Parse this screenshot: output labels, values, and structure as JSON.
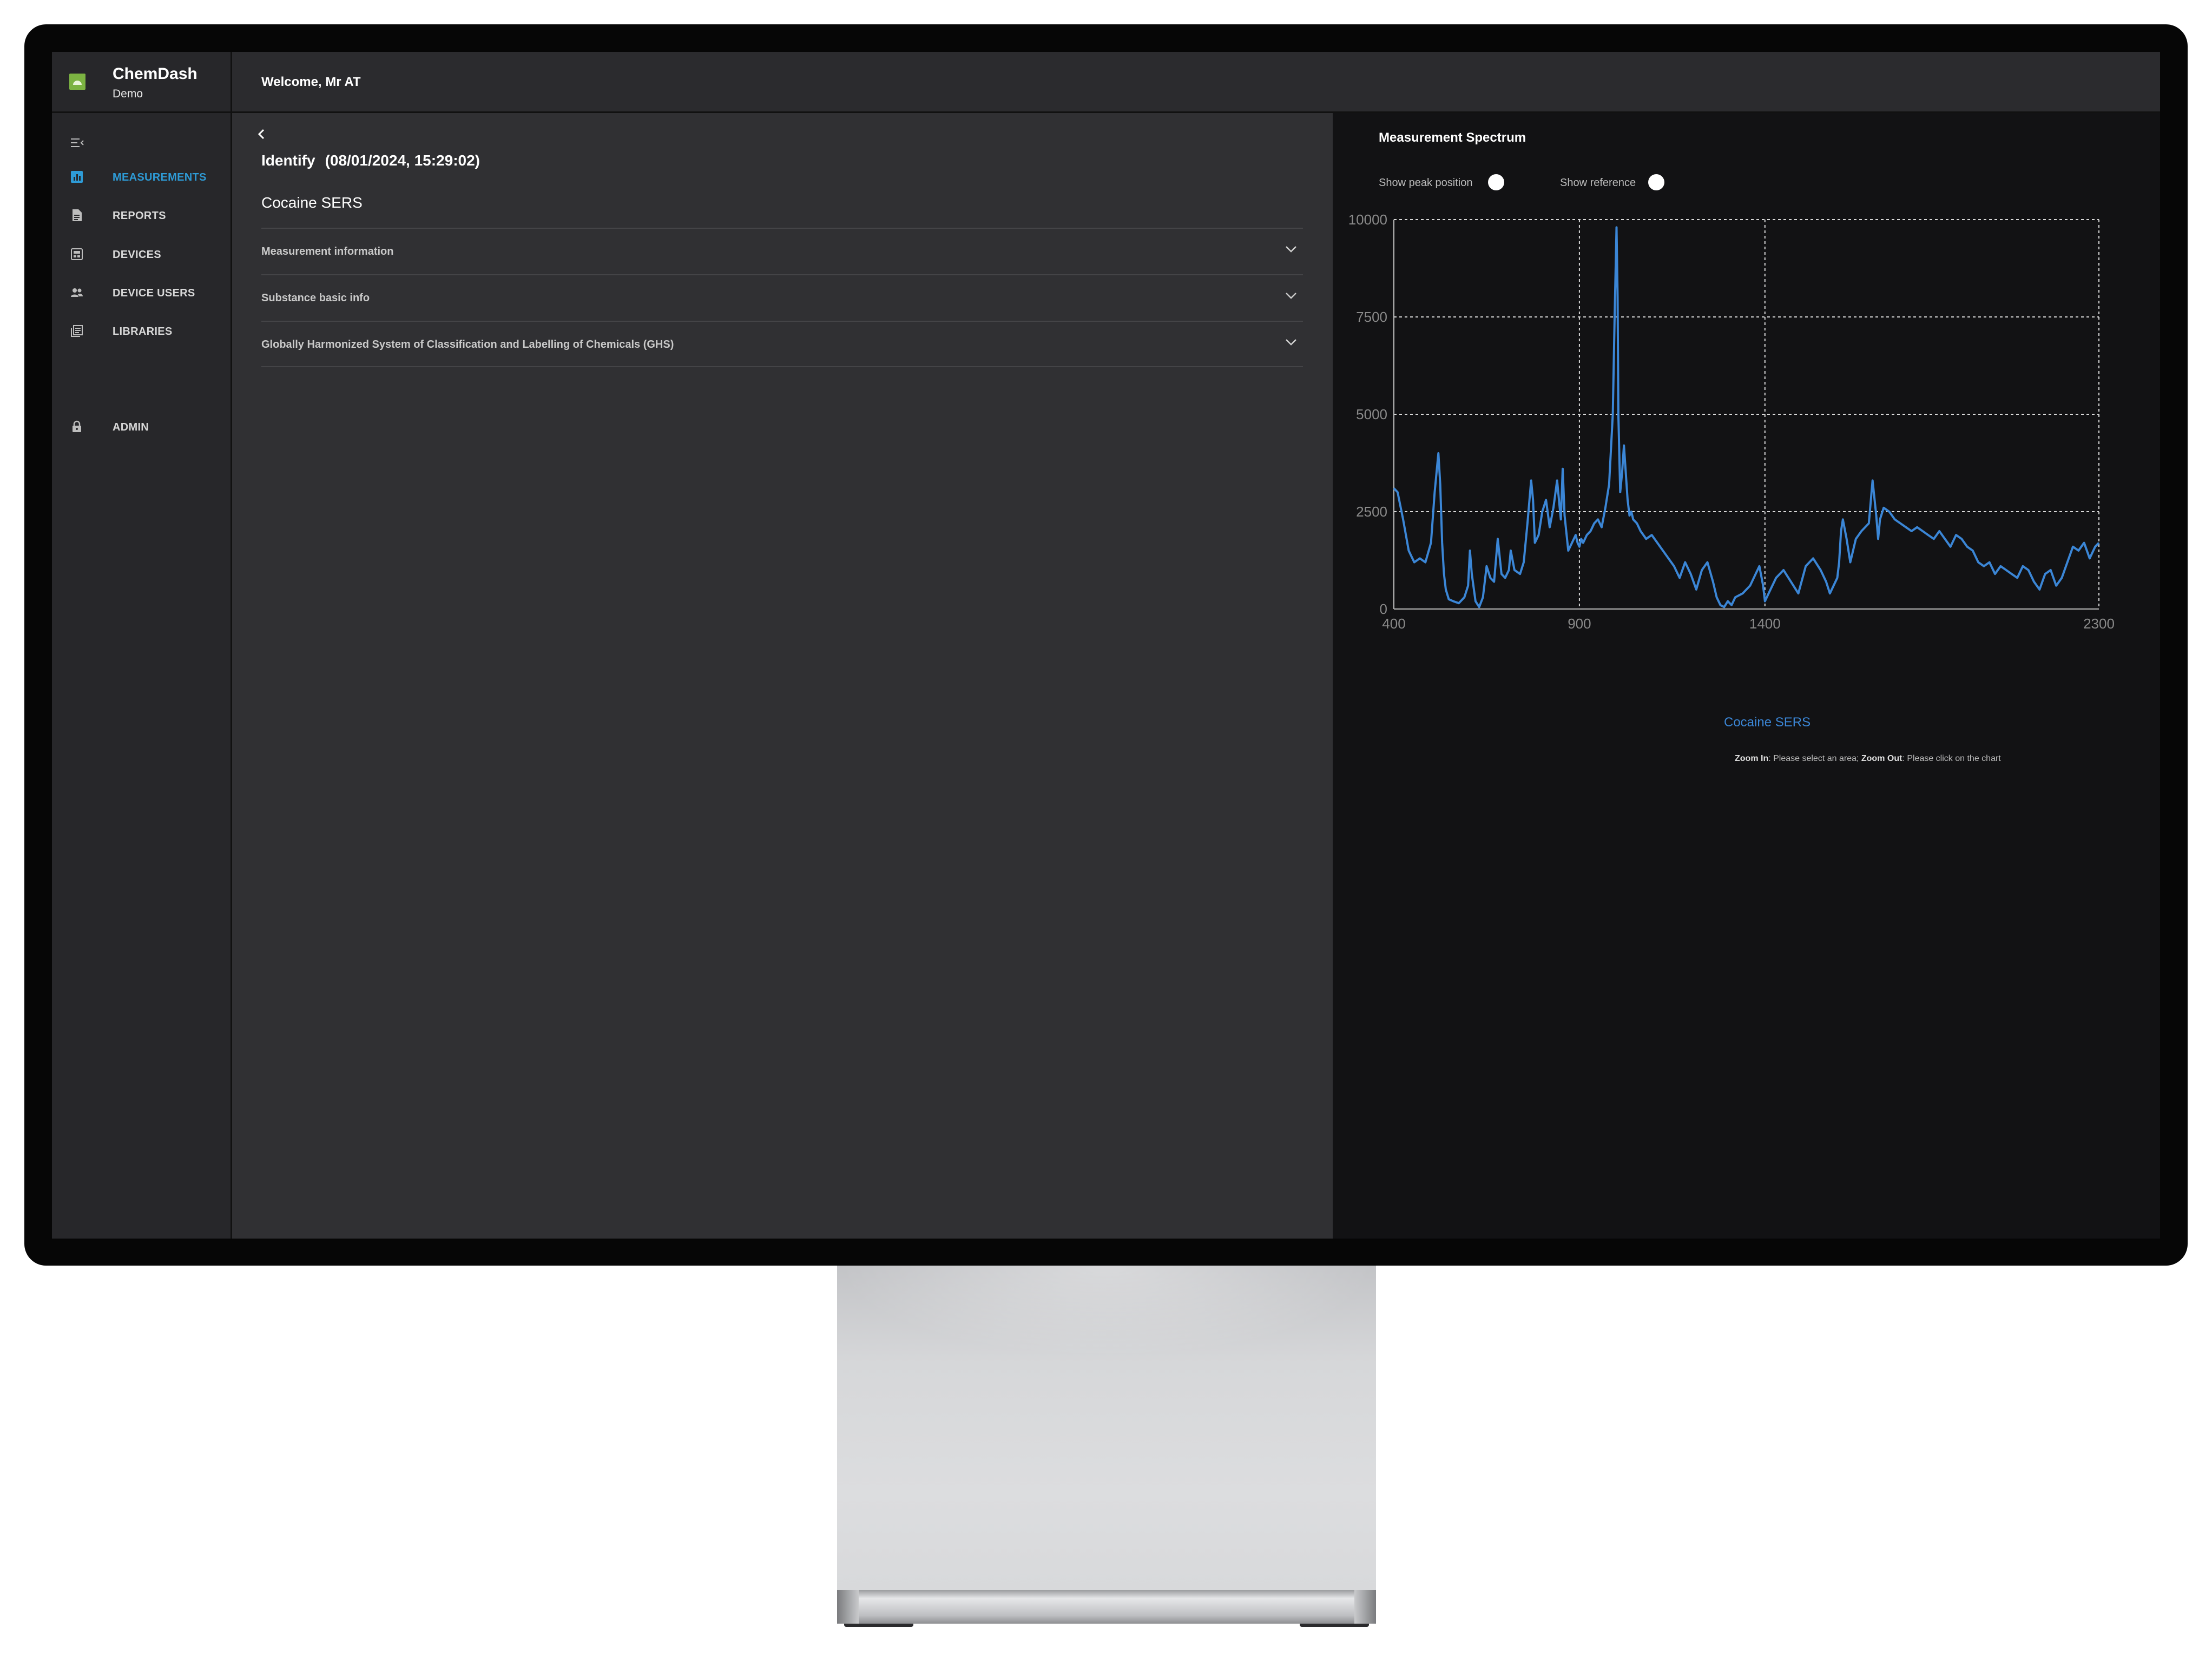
{
  "brand": {
    "name": "ChemDash",
    "subtitle": "Demo",
    "logo_color": "#7cb342"
  },
  "header": {
    "welcome": "Welcome, Mr AT"
  },
  "sidebar": {
    "collapse_icon": "menu-collapse-icon",
    "items": [
      {
        "label": "MEASUREMENTS",
        "icon": "bar-chart-icon",
        "active": true
      },
      {
        "label": "REPORTS",
        "icon": "document-icon",
        "active": false
      },
      {
        "label": "DEVICES",
        "icon": "device-icon",
        "active": false
      },
      {
        "label": "DEVICE USERS",
        "icon": "users-icon",
        "active": false
      },
      {
        "label": "LIBRARIES",
        "icon": "library-icon",
        "active": false
      },
      {
        "label": "ADMIN",
        "icon": "lock-icon",
        "active": false
      }
    ],
    "active_color": "#2e9bd6"
  },
  "main": {
    "title": "Identify",
    "date": "(08/01/2024, 15:29:02)",
    "substance": "Cocaine SERS",
    "sections": [
      {
        "label": "Measurement information"
      },
      {
        "label": "Substance basic info"
      },
      {
        "label": "Globally Harmonized System of Classification and Labelling of Chemicals (GHS)"
      }
    ]
  },
  "spectrum": {
    "title": "Measurement Spectrum",
    "toggles": [
      {
        "label": "Show peak position",
        "on": false
      },
      {
        "label": "Show reference",
        "on": false
      }
    ],
    "zoom_in_label": "Zoom In",
    "zoom_in_text": ": Please select an area; ",
    "zoom_out_label": "Zoom Out",
    "zoom_out_text": ": Please click on the chart"
  },
  "chart_data": {
    "type": "line",
    "xlim": [
      400,
      2300
    ],
    "ylim": [
      0,
      10000
    ],
    "x_ticks": [
      "400",
      "900",
      "1400",
      "2300"
    ],
    "y_ticks": [
      "0",
      "2500",
      "5000",
      "7500",
      "10000"
    ],
    "grid": true,
    "series": [
      {
        "name": "Cocaine SERS",
        "color": "#3b86d6",
        "x": [
          400,
          410,
          425,
          440,
          455,
          470,
          485,
          500,
          510,
          520,
          525,
          530,
          535,
          540,
          548,
          560,
          575,
          590,
          600,
          605,
          610,
          620,
          630,
          640,
          650,
          660,
          670,
          680,
          690,
          700,
          710,
          715,
          725,
          740,
          750,
          760,
          770,
          775,
          780,
          790,
          800,
          810,
          820,
          830,
          840,
          850,
          855,
          860,
          870,
          880,
          890,
          895,
          900,
          905,
          910,
          920,
          930,
          940,
          950,
          960,
          970,
          980,
          990,
          995,
          1000,
          1003,
          1005,
          1010,
          1015,
          1020,
          1025,
          1030,
          1035,
          1040,
          1045,
          1055,
          1065,
          1080,
          1095,
          1110,
          1125,
          1140,
          1155,
          1170,
          1185,
          1200,
          1215,
          1230,
          1245,
          1260,
          1270,
          1280,
          1290,
          1300,
          1310,
          1320,
          1340,
          1360,
          1375,
          1385,
          1395,
          1400,
          1410,
          1430,
          1450,
          1470,
          1490,
          1510,
          1530,
          1550,
          1565,
          1575,
          1585,
          1595,
          1600,
          1605,
          1610,
          1620,
          1630,
          1645,
          1660,
          1670,
          1680,
          1690,
          1700,
          1705,
          1710,
          1720,
          1735,
          1750,
          1765,
          1780,
          1795,
          1810,
          1825,
          1840,
          1855,
          1870,
          1885,
          1900,
          1915,
          1930,
          1945,
          1960,
          1975,
          1990,
          2005,
          2020,
          2035,
          2050,
          2065,
          2080,
          2095,
          2110,
          2125,
          2140,
          2155,
          2170,
          2185,
          2200,
          2215,
          2230,
          2245,
          2260,
          2275,
          2290,
          2300
        ],
        "y": [
          3100,
          3000,
          2300,
          1500,
          1200,
          1300,
          1200,
          1700,
          3000,
          4000,
          3200,
          1700,
          900,
          500,
          250,
          200,
          150,
          300,
          600,
          1500,
          900,
          200,
          50,
          300,
          1100,
          800,
          700,
          1800,
          900,
          800,
          1000,
          1500,
          1000,
          900,
          1200,
          2200,
          3300,
          2800,
          1700,
          1900,
          2500,
          2800,
          2100,
          2600,
          3300,
          2300,
          3600,
          2400,
          1500,
          1700,
          1900,
          1700,
          1600,
          1800,
          1700,
          1900,
          2000,
          2200,
          2300,
          2100,
          2600,
          3200,
          5000,
          7500,
          9800,
          8000,
          5000,
          3000,
          3500,
          4200,
          3500,
          2800,
          2400,
          2500,
          2300,
          2200,
          2000,
          1800,
          1900,
          1700,
          1500,
          1300,
          1100,
          800,
          1200,
          900,
          500,
          1000,
          1200,
          700,
          300,
          100,
          50,
          200,
          100,
          300,
          400,
          600,
          900,
          1100,
          600,
          200,
          400,
          800,
          1000,
          700,
          400,
          1100,
          1300,
          1000,
          700,
          400,
          600,
          800,
          1200,
          2000,
          2300,
          1800,
          1200,
          1800,
          2000,
          2100,
          2200,
          3300,
          2400,
          1800,
          2300,
          2600,
          2500,
          2300,
          2200,
          2100,
          2000,
          2100,
          2000,
          1900,
          1800,
          2000,
          1800,
          1600,
          1900,
          1800,
          1600,
          1500,
          1200,
          1100,
          1200,
          900,
          1100,
          1000,
          900,
          800,
          1100,
          1000,
          700,
          500,
          900,
          1000,
          600,
          800,
          1200,
          1600,
          1500,
          1700,
          1300,
          1600,
          1700
        ]
      }
    ]
  }
}
